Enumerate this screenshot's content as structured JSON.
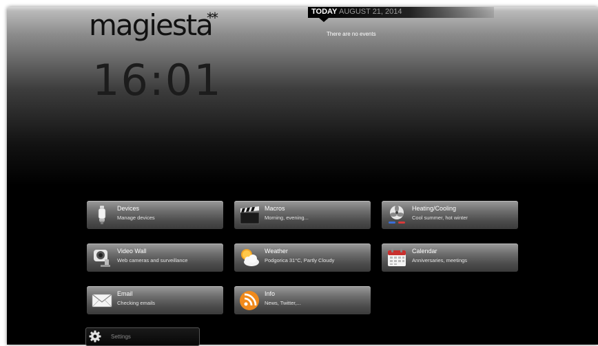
{
  "header": {
    "logo": "magiesta",
    "logo_mark": "**",
    "clock": "16:01"
  },
  "events": {
    "today_label": "TODAY",
    "date": "AUGUST 21, 2014",
    "empty_text": "There are no events"
  },
  "tiles": [
    {
      "title": "Devices",
      "subtitle": "Manage devices",
      "icon": "light-bulb-icon"
    },
    {
      "title": "Macros",
      "subtitle": "Morning, evening...",
      "icon": "clapperboard-icon"
    },
    {
      "title": "Heating/Cooling",
      "subtitle": "Cool summer, hot winter",
      "icon": "fan-icon"
    },
    {
      "title": "Video Wall",
      "subtitle": "Web cameras and surveillance",
      "icon": "camera-icon"
    },
    {
      "title": "Weather",
      "subtitle": "Podgorica 31°C, Partly Cloudy",
      "icon": "sun-cloud-icon"
    },
    {
      "title": "Calendar",
      "subtitle": "Anniversaries, meetings",
      "icon": "calendar-icon"
    },
    {
      "title": "Email",
      "subtitle": "Checking emails",
      "icon": "envelope-icon"
    },
    {
      "title": "Info",
      "subtitle": "News, Twitter,...",
      "icon": "rss-icon"
    }
  ],
  "settings": {
    "label": "Settings",
    "icon": "gear-icon"
  }
}
